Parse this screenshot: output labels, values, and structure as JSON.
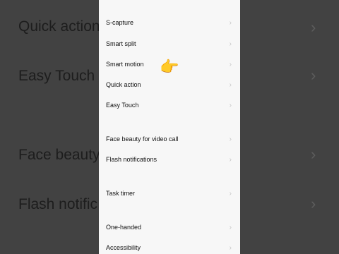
{
  "background_left": {
    "items": [
      "Quick action",
      "Easy Touch",
      "Face beauty",
      "Flash notific"
    ]
  },
  "settings_list": {
    "items": [
      {
        "label": "S-capture"
      },
      {
        "label": "Smart split"
      },
      {
        "label": "Smart motion"
      },
      {
        "label": "Quick action"
      },
      {
        "label": "Easy Touch"
      },
      {
        "label": "Face beauty for video call"
      },
      {
        "label": "Flash notifications"
      },
      {
        "label": "Task timer"
      },
      {
        "label": "One-handed"
      },
      {
        "label": "Accessibility"
      }
    ]
  },
  "icons": {
    "chevron": "chevron-right-icon",
    "pointer": "pointing-hand-emoji"
  },
  "pointer_emoji": "👉",
  "chevron_glyph": "›"
}
